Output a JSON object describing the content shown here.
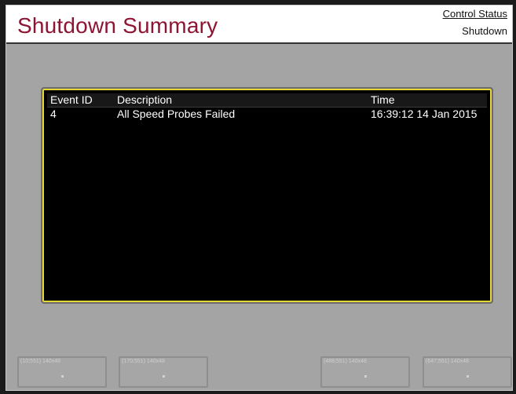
{
  "header": {
    "title": "Shutdown Summary",
    "status_link": "Control Status",
    "status_value": "Shutdown"
  },
  "table": {
    "columns": [
      "Event ID",
      "Description",
      "Time"
    ],
    "rows": [
      {
        "event_id": "4",
        "description": "All Speed Probes Failed",
        "time": "16:39:12 14 Jan 2015"
      }
    ]
  },
  "placeholders": [
    {
      "label": "(10;551) 140x48"
    },
    {
      "label": "(170;551) 140x48"
    },
    {
      "label": "(488;551) 140x48"
    },
    {
      "label": "(647;551) 140x48"
    }
  ],
  "colors": {
    "title": "#8d1432",
    "panel": "#a4a4a4",
    "table_border": "#e7d63a"
  }
}
